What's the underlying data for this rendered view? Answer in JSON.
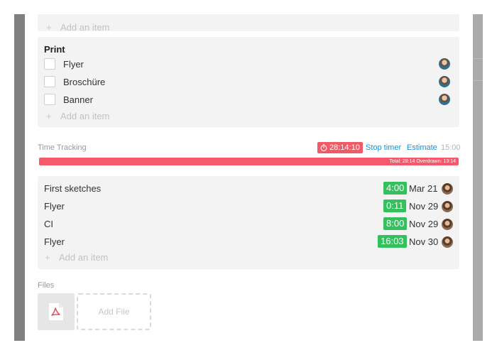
{
  "checklist_top": {
    "add_item_label": "Add an item"
  },
  "print_checklist": {
    "title": "Print",
    "items": [
      {
        "label": "Flyer",
        "checked": false
      },
      {
        "label": "Broschüre",
        "checked": false
      },
      {
        "label": "Banner",
        "checked": false
      }
    ],
    "add_item_label": "Add an item"
  },
  "time_tracking": {
    "label": "Time Tracking",
    "timer": "28:14:10",
    "stop_timer_label": "Stop timer",
    "estimate_label": "Estimate",
    "estimate_value": "15:00",
    "progress_text": "Total: 28:14   Overdrawn: 13:14",
    "entries": [
      {
        "name": "First sketches",
        "duration": "4:00",
        "date": "Mar 21"
      },
      {
        "name": "Flyer",
        "duration": "0:11",
        "date": "Nov 29"
      },
      {
        "name": "CI",
        "duration": "8:00",
        "date": "Nov 29"
      },
      {
        "name": "Flyer",
        "duration": "16:03",
        "date": "Nov 30"
      }
    ],
    "add_item_label": "Add an item"
  },
  "files": {
    "label": "Files",
    "add_file_label": "Add File",
    "items": [
      {
        "type_icon": "pdf-icon"
      }
    ]
  },
  "colors": {
    "timer_red": "#f05a66",
    "progress_red": "#f5586a",
    "duration_green": "#33c05d",
    "link_blue": "#1a8fd6"
  }
}
